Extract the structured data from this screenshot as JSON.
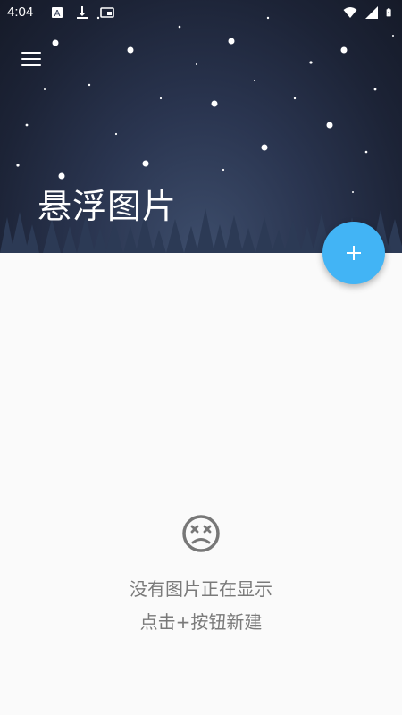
{
  "status_bar": {
    "time": "4:04",
    "left_icons": [
      "android-notification-icon",
      "download-icon",
      "picture-in-picture-icon"
    ],
    "right_icons": [
      "wifi-icon",
      "cell-signal-icon",
      "battery-icon"
    ]
  },
  "header": {
    "title": "悬浮图片",
    "menu_icon": "hamburger-menu-icon"
  },
  "fab": {
    "icon": "plus-icon",
    "color": "#42b4f5"
  },
  "empty_state": {
    "icon": "sad-face-icon",
    "line1": "没有图片正在显示",
    "line2": "点击+按钮新建"
  }
}
